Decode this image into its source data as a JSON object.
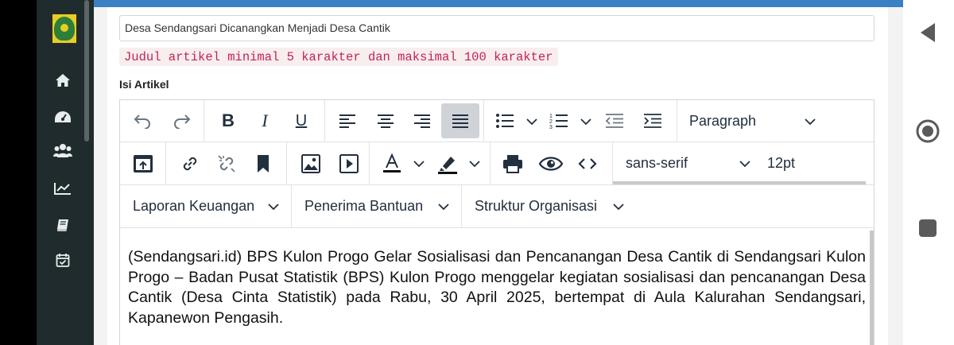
{
  "article": {
    "title_value": "Desa Sendangsari Dicanangkan Menjadi Desa Cantik",
    "title_hint": "Judul artikel minimal 5 karakter dan maksimal 100 karakter",
    "content_label": "Isi Artikel",
    "content_text": "(Sendangsari.id) BPS Kulon Progo Gelar Sosialisasi dan Pencanangan Desa Cantik di Sendangsari Kulon Progo – Badan Pusat Statistik (BPS) Kulon Progo menggelar kegiatan sosialisasi dan pencanangan Desa Cantik (Desa Cinta Statistik) pada Rabu, 30 April 2025, bertempat di Aula Kalurahan Sendangsari, Kapanewon Pengasih."
  },
  "toolbar": {
    "block_format": "Paragraph",
    "font_family": "sans-serif",
    "font_size": "12pt",
    "bold_label": "B",
    "italic_label": "I",
    "underline_label": "U",
    "custom_menus": [
      "Laporan Keuangan",
      "Penerima Bantuan",
      "Struktur Organisasi"
    ],
    "active_alignment": "justify"
  },
  "sidebar": {
    "icons": [
      "home-icon",
      "dashboard-icon",
      "users-icon",
      "chart-icon",
      "book-icon",
      "calendar-check-icon"
    ]
  },
  "navbar": {
    "icons": [
      "back-icon",
      "home-icon",
      "recents-icon"
    ]
  },
  "colors": {
    "topbar": "#3b7fc4",
    "sidebar": "#1f2b2c",
    "hint_text": "#c0235a",
    "hint_bg": "#f8eeee"
  }
}
